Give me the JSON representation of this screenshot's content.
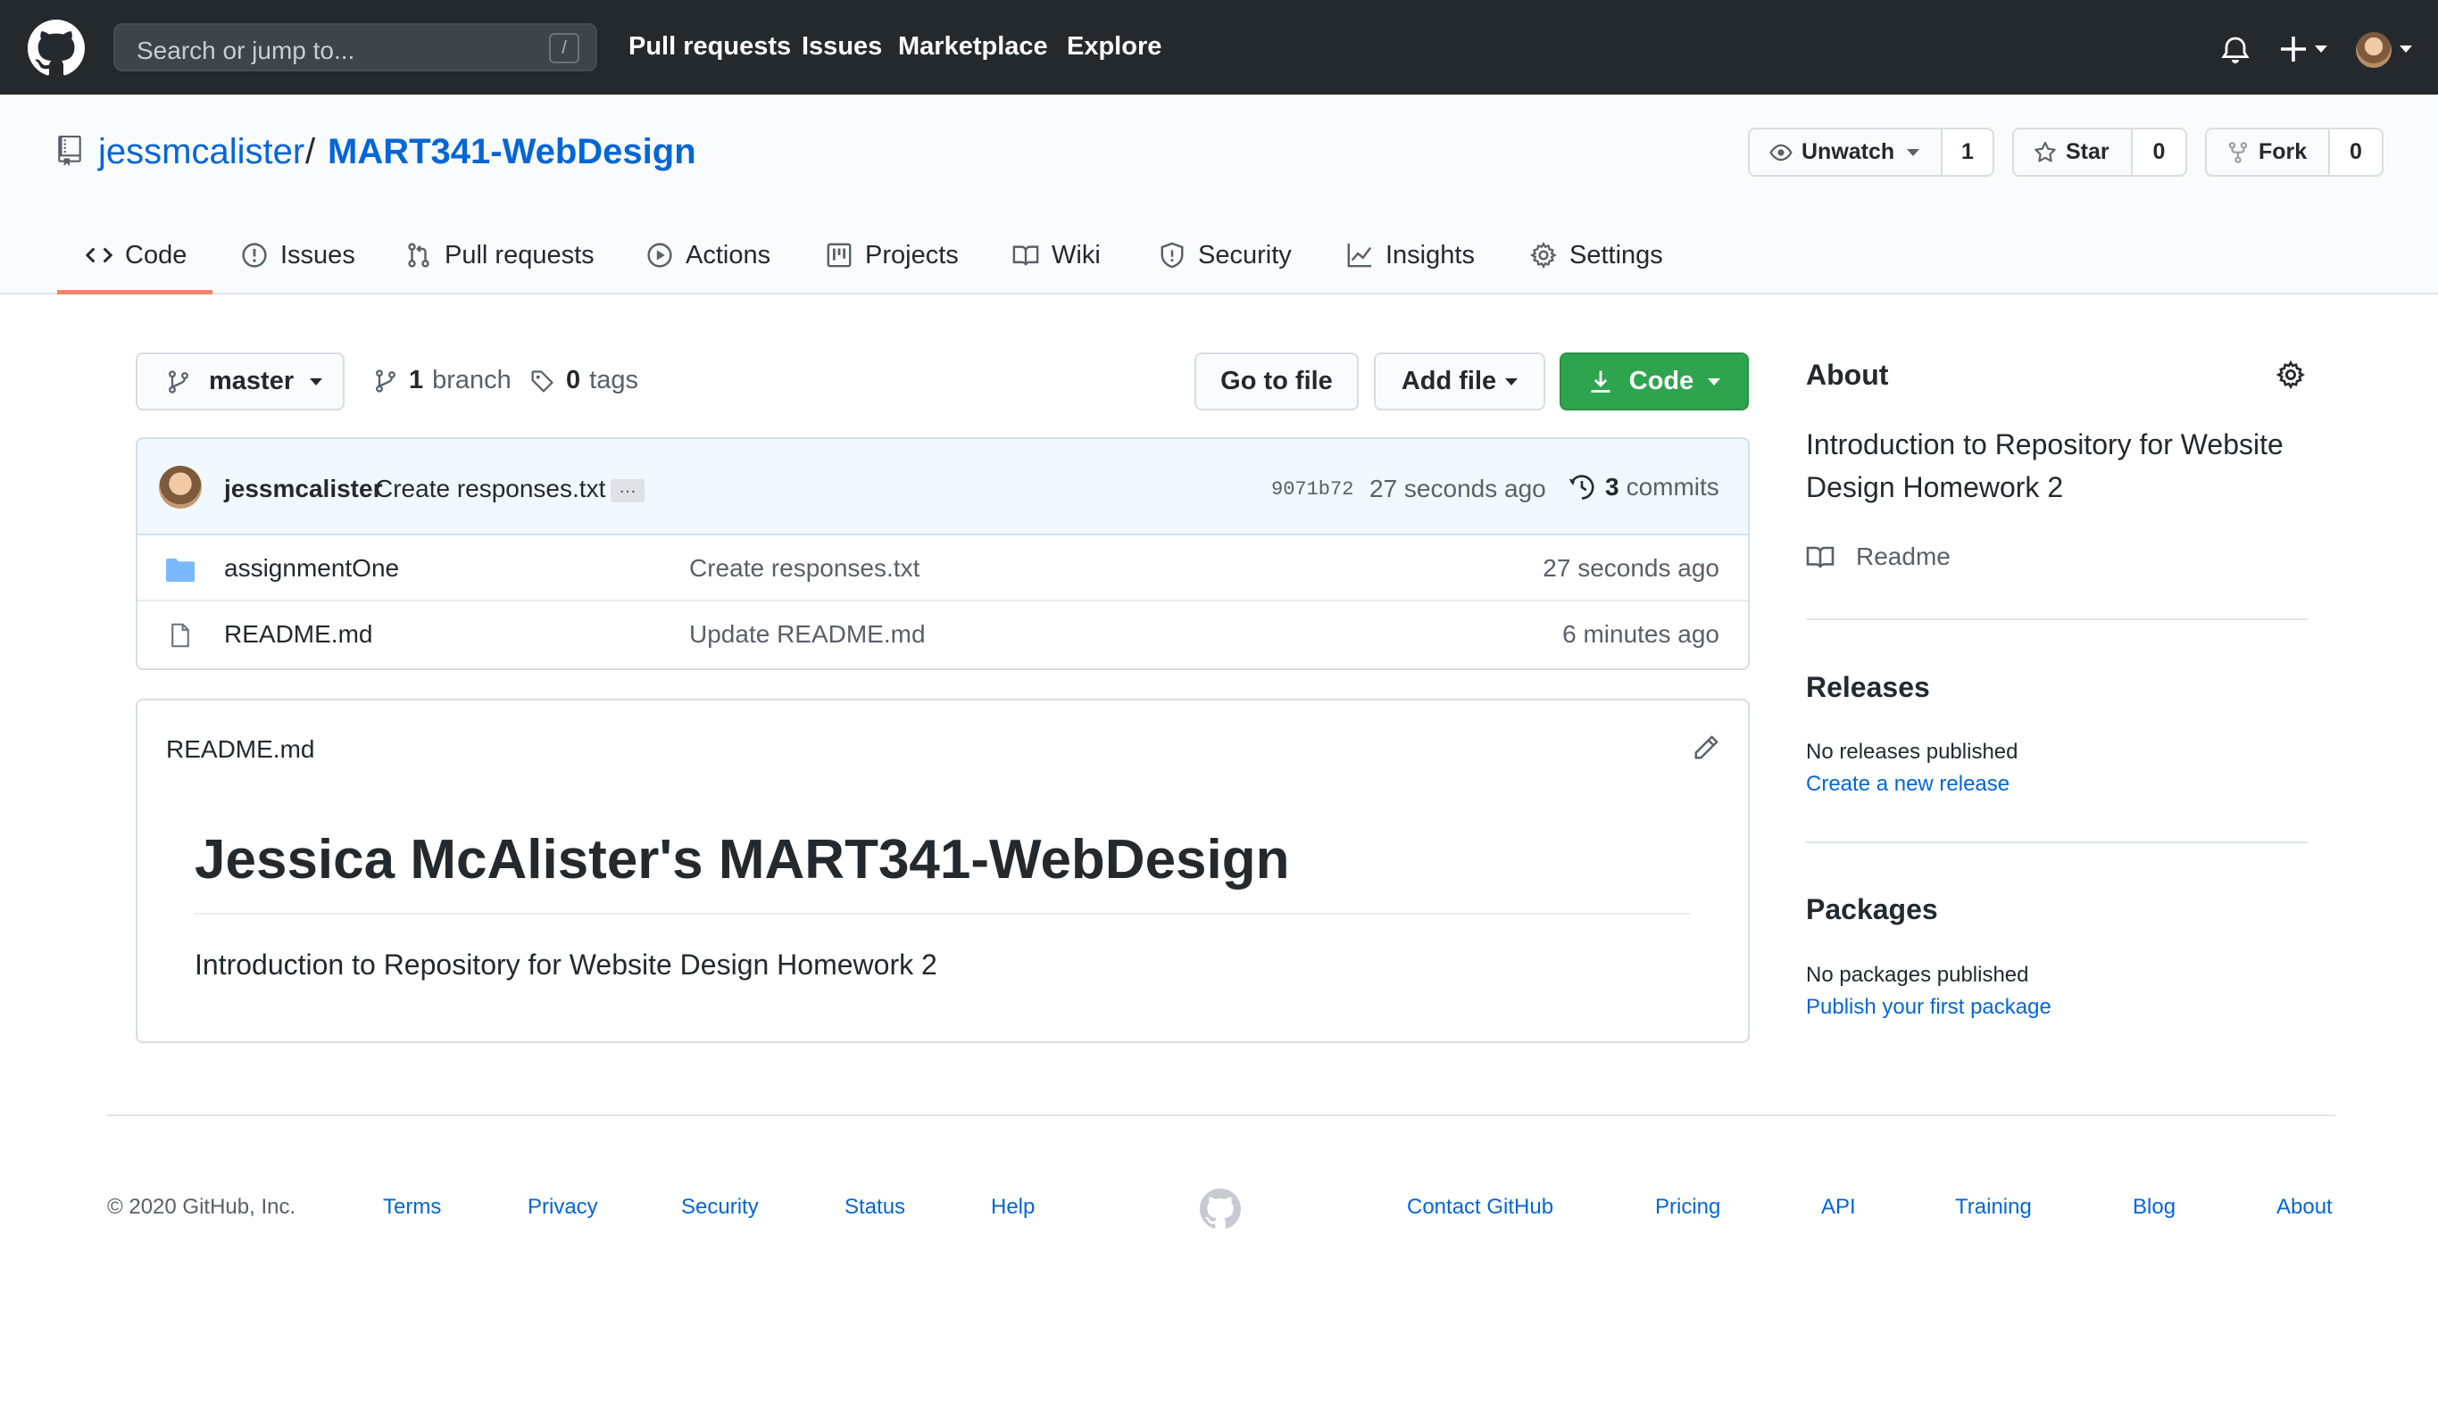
{
  "header": {
    "search_placeholder": "Search or jump to...",
    "search_shortcut": "/",
    "nav": [
      "Pull requests",
      "Issues",
      "Marketplace",
      "Explore"
    ]
  },
  "repo": {
    "owner": "jessmcalister",
    "separator": "/",
    "name": "MART341-WebDesign",
    "watch_label": "Unwatch",
    "watch_count": "1",
    "star_label": "Star",
    "star_count": "0",
    "fork_label": "Fork",
    "fork_count": "0"
  },
  "tabs": [
    {
      "label": "Code",
      "icon": "code-icon",
      "active": true
    },
    {
      "label": "Issues",
      "icon": "issue-opened-icon"
    },
    {
      "label": "Pull requests",
      "icon": "git-pull-request-icon"
    },
    {
      "label": "Actions",
      "icon": "play-icon"
    },
    {
      "label": "Projects",
      "icon": "project-icon"
    },
    {
      "label": "Wiki",
      "icon": "book-icon"
    },
    {
      "label": "Security",
      "icon": "shield-icon"
    },
    {
      "label": "Insights",
      "icon": "graph-icon"
    },
    {
      "label": "Settings",
      "icon": "gear-icon"
    }
  ],
  "toolbar": {
    "branch": "master",
    "branch_count": "1",
    "branch_word": "branch",
    "tag_count": "0",
    "tag_word": "tags",
    "go_to_file": "Go to file",
    "add_file": "Add file",
    "code": "Code"
  },
  "commit": {
    "author": "jessmcalister",
    "message": "Create responses.txt",
    "ellipsis": "…",
    "sha": "9071b72",
    "time": "27 seconds ago",
    "count": "3",
    "count_word": "commits"
  },
  "files": [
    {
      "name": "assignmentOne",
      "type": "directory",
      "message": "Create responses.txt",
      "age": "27 seconds ago"
    },
    {
      "name": "README.md",
      "type": "file",
      "message": "Update README.md",
      "age": "6 minutes ago"
    }
  ],
  "readme": {
    "filename": "README.md",
    "heading": "Jessica McAlister's MART341-WebDesign",
    "body": "Introduction to Repository for Website Design Homework 2"
  },
  "sidebar": {
    "about_title": "About",
    "about_description": "Introduction to Repository for Website Design Homework 2",
    "readme_label": "Readme",
    "releases_title": "Releases",
    "releases_empty": "No releases published",
    "releases_link": "Create a new release",
    "packages_title": "Packages",
    "packages_empty": "No packages published",
    "packages_link": "Publish your first package"
  },
  "footer": {
    "copyright": "© 2020 GitHub, Inc.",
    "left_links": [
      "Terms",
      "Privacy",
      "Security",
      "Status",
      "Help"
    ],
    "right_links": [
      "Contact GitHub",
      "Pricing",
      "API",
      "Training",
      "Blog",
      "About"
    ]
  },
  "colors": {
    "header_bg": "#24292e",
    "link": "#0366d6",
    "primary_button": "#2ea44f",
    "active_tab_underline": "#f9826c",
    "folder": "#79b8ff"
  }
}
